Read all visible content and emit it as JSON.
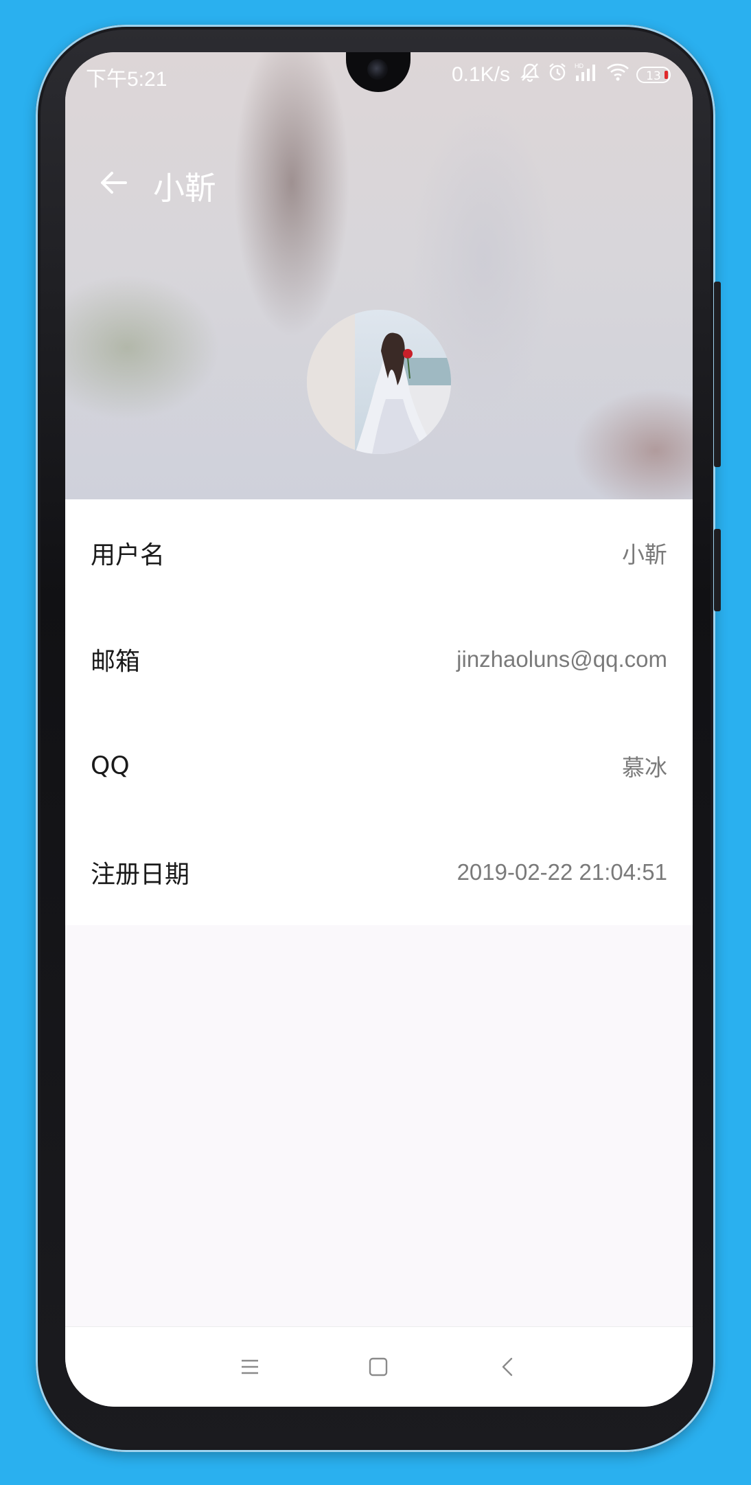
{
  "status_bar": {
    "time": "下午5:21",
    "network_speed": "0.1K/s",
    "battery_level": "13"
  },
  "app_bar": {
    "title": "小靳"
  },
  "profile": {
    "fields": [
      {
        "label": "用户名",
        "value": "小靳"
      },
      {
        "label": "邮箱",
        "value": "jinzhaoluns@qq.com"
      },
      {
        "label": "QQ",
        "value": "慕冰"
      },
      {
        "label": "注册日期",
        "value": "2019-02-22 21:04:51"
      }
    ]
  },
  "colors": {
    "background": "#2ab0ef",
    "label_text": "#1a1a1a",
    "value_text": "#7a7a7a",
    "battery_low": "#e0282b"
  },
  "icons": {
    "back": "arrow-left-icon",
    "nav_menu": "menu-icon",
    "nav_home": "home-icon",
    "nav_back": "chevron-left-icon"
  }
}
